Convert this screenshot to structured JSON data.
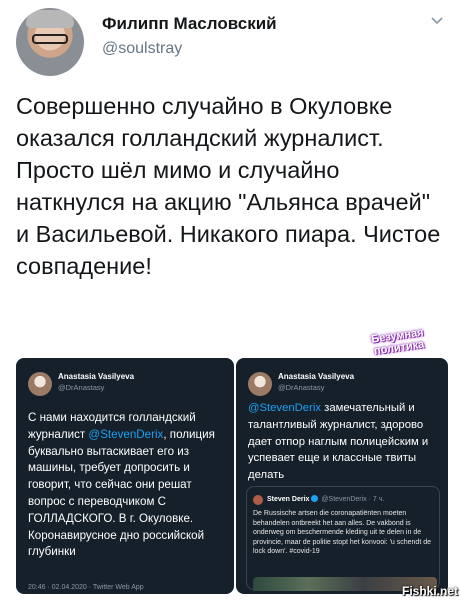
{
  "author": {
    "name": "Филипп Масловский",
    "handle": "@soulstray"
  },
  "tweet": {
    "text": "Совершенно случайно в Окуловке оказался голландский журналист. Просто шёл мимо и случайно наткнулся на акцию \"Альянса врачей\" и Васильевой. Никакого пиара. Чистое совпадение!"
  },
  "screenshot_left": {
    "name": "Anastasia Vasilyeva",
    "handle": "@DrAnastasy",
    "text_before": "С нами находится голландский журналист ",
    "mention": "@StevenDerix",
    "text_after": ", полиция буквально вытаскивает его из машины, требует допросить и говорит, что сейчас они решат вопрос с переводчиком С ГОЛЛАДСКОГО. В г. Окуловке. Коронавирусное дно российской глубинки",
    "footer": "20:46 · 02.04.2020 · Twitter Web App"
  },
  "screenshot_right": {
    "name": "Anastasia Vasilyeva",
    "handle": "@DrAnastasy",
    "mention": "@StevenDerix",
    "text_after": " замечательный и талантливый журналист, здорово дает отпор наглым полицейским и успевает еще и классные твиты делать",
    "quote": {
      "name": "Steven Derix",
      "meta": "@StevenDerix · 7 ч.",
      "text": "De Russische artsen die coronapatiënten moeten behandelen ontbreekt het aan alles. De vakbond is onderweg om beschermende kleding uit te delen in de provincie, maar de politie stopt het konvooi: 'u schendt de lock down'. #covid-19"
    }
  },
  "watermark": {
    "line1": "Безумная",
    "line2": "политика"
  },
  "credit": "Fishki.net",
  "colors": {
    "mention": "#1da1f2",
    "dark_bg": "#15202b",
    "secondary_text": "#657786"
  },
  "icons": [
    "chevron-down-icon",
    "verified-badge-icon"
  ]
}
